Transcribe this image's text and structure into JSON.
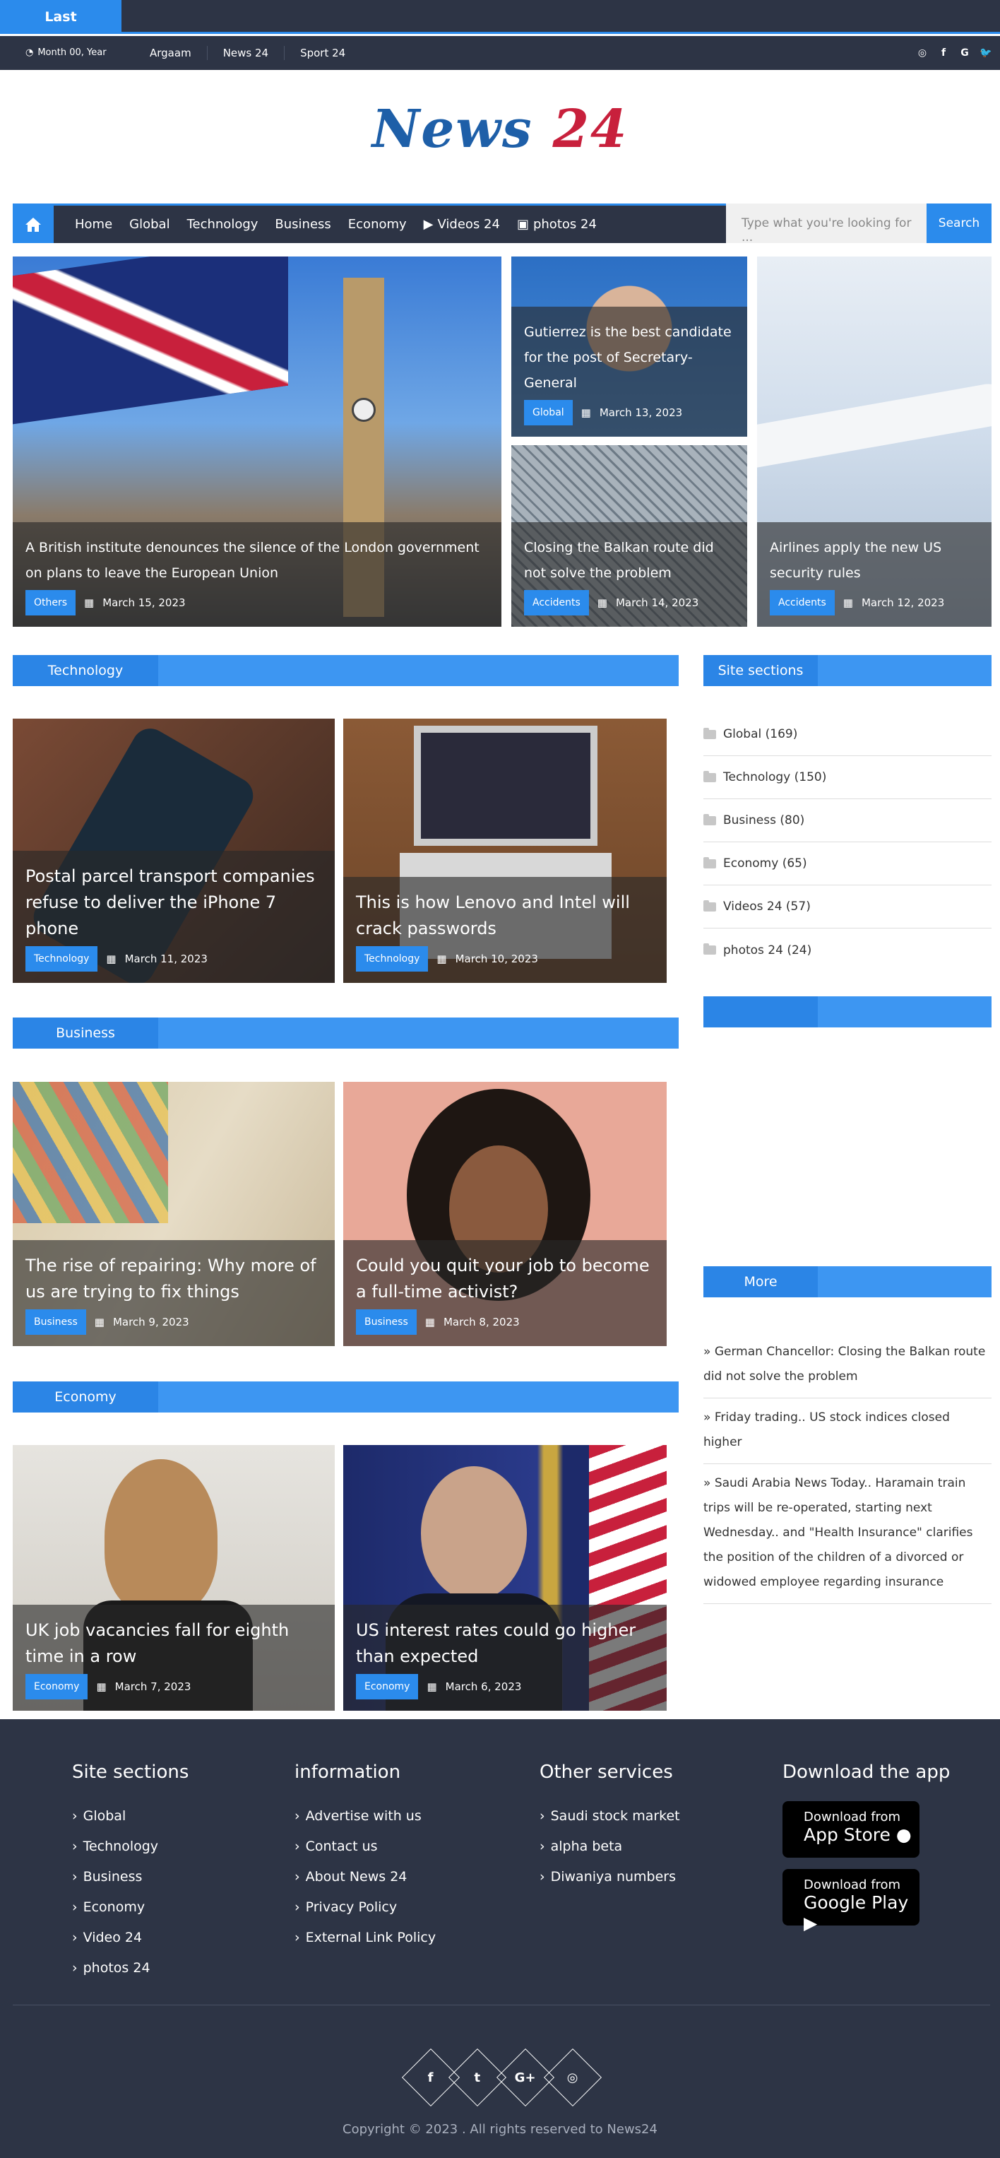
{
  "topbar": {
    "last_label": "Last"
  },
  "subbar": {
    "date": "Month 00, Year",
    "links": [
      "Argaam",
      "News 24",
      "Sport 24"
    ],
    "social_icons": [
      "instagram-icon",
      "facebook-icon",
      "google-icon",
      "twitter-icon"
    ]
  },
  "logo": {
    "part1": "News",
    "part2": "24"
  },
  "nav": {
    "items": [
      "Home",
      "Global",
      "Technology",
      "Business",
      "Economy",
      "Videos 24",
      "photos 24"
    ],
    "search_placeholder": "Type what you're looking for ...",
    "search_button": "Search"
  },
  "hero": [
    {
      "title": "A British institute denounces the silence of the London government on plans to leave the European Union",
      "category": "Others",
      "date": "March 15, 2023"
    },
    {
      "title": "Gutierrez is the best candidate for the post of Secretary-General",
      "category": "Global",
      "date": "March 13, 2023"
    },
    {
      "title": "Closing the Balkan route did not solve the problem",
      "category": "Accidents",
      "date": "March 14, 2023"
    },
    {
      "title": "Airlines apply the new US security rules",
      "category": "Accidents",
      "date": "March 12, 2023"
    }
  ],
  "sections": {
    "technology": {
      "title": "Technology",
      "posts": [
        {
          "title": "Postal parcel transport companies refuse to deliver the iPhone 7 phone",
          "category": "Technology",
          "date": "March 11, 2023"
        },
        {
          "title": "This is how Lenovo and Intel will crack passwords",
          "category": "Technology",
          "date": "March 10, 2023"
        }
      ]
    },
    "business": {
      "title": "Business",
      "posts": [
        {
          "title": "The rise of repairing: Why more of us are trying to fix things",
          "category": "Business",
          "date": "March 9, 2023"
        },
        {
          "title": "Could you quit your job to become a full-time activist?",
          "category": "Business",
          "date": "March 8, 2023"
        }
      ]
    },
    "economy": {
      "title": "Economy",
      "posts": [
        {
          "title": "UK job vacancies fall for eighth time in a row",
          "category": "Economy",
          "date": "March 7, 2023"
        },
        {
          "title": "US interest rates could go higher than expected",
          "category": "Economy",
          "date": "March 6, 2023"
        }
      ]
    }
  },
  "sidebar": {
    "sections_title": "Site sections",
    "sections": [
      "Global (169)",
      "Technology (150)",
      "Business (80)",
      "Economy (65)",
      "Videos 24 (57)",
      "photos 24 (24)"
    ],
    "more_title": "More",
    "more": [
      "German Chancellor: Closing the Balkan route did not solve the problem",
      "Friday trading.. US stock indices closed higher",
      "Saudi Arabia News Today.. Haramain train trips will be re-operated, starting next Wednesday.. and \"Health Insurance\" clarifies the position of the children of a divorced or widowed employee regarding insurance"
    ]
  },
  "footer": {
    "col1": {
      "title": "Site sections",
      "items": [
        "Global",
        "Technology",
        "Business",
        "Economy",
        "Video 24",
        "photos 24"
      ]
    },
    "col2": {
      "title": "information",
      "items": [
        "Advertise with us",
        "Contact us",
        "About News 24",
        "Privacy Policy",
        "External Link Policy"
      ]
    },
    "col3": {
      "title": "Other services",
      "items": [
        "Saudi stock market",
        "alpha beta",
        "Diwaniya numbers"
      ]
    },
    "col4": {
      "title": "Download the app",
      "appstore_1": "Download from",
      "appstore_2": "App Store",
      "gplay_1": "Download from",
      "gplay_2": "Google Play"
    },
    "copyright": "Copyright © 2023 . All rights reserved to News24"
  },
  "colors": {
    "accent": "#2b8bec",
    "dark": "#2d3445",
    "logo_blue": "#1e5fa8",
    "logo_red": "#c8203c"
  }
}
